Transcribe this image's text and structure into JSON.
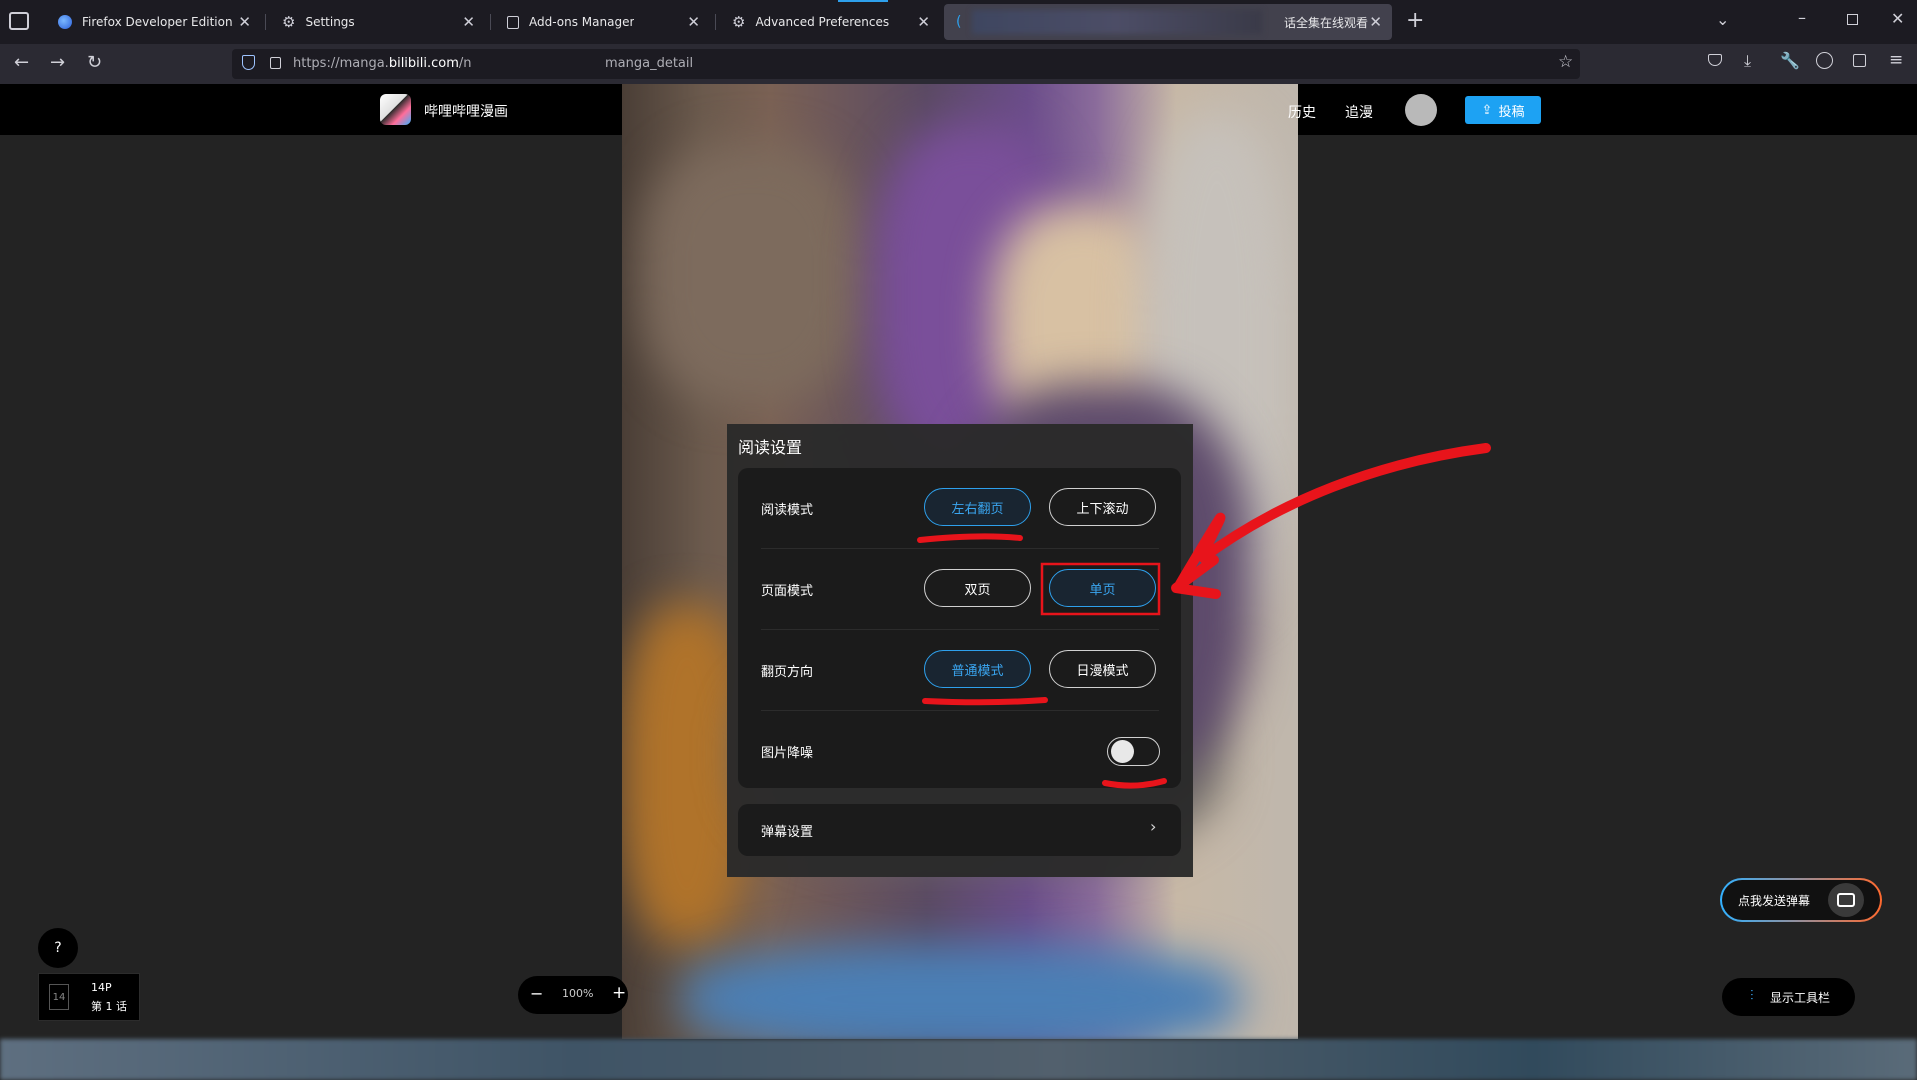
{
  "browser": {
    "tabs": [
      {
        "label": "Firefox Developer Edition",
        "icon": "firefox-icon"
      },
      {
        "label": "Settings",
        "icon": "gear-icon"
      },
      {
        "label": "Add-ons Manager",
        "icon": "puzzle-icon"
      },
      {
        "label": "Advanced Preferences",
        "icon": "gear-icon"
      },
      {
        "label": "话全集在线观看",
        "icon": "loading-icon"
      }
    ],
    "url_prefix": "https://manga.",
    "url_domain": "bilibili.com",
    "url_path": "/n",
    "url_suffix": "manga_detail"
  },
  "site": {
    "logo_text": "哔哩哔哩漫画",
    "nav_history": "历史",
    "nav_follow": "追漫",
    "upload_label": "投稿"
  },
  "settings": {
    "title": "阅读设置",
    "reading_mode_label": "阅读模式",
    "reading_mode_options": [
      "左右翻页",
      "上下滚动"
    ],
    "reading_mode_selected": "左右翻页",
    "page_mode_label": "页面模式",
    "page_mode_options": [
      "双页",
      "单页"
    ],
    "page_mode_selected": "单页",
    "direction_label": "翻页方向",
    "direction_options": [
      "普通模式",
      "日漫模式"
    ],
    "direction_selected": "普通模式",
    "denoise_label": "图片降噪",
    "denoise_on": false,
    "danmaku_settings_label": "弹幕设置"
  },
  "controls": {
    "send_danmaku_label": "点我发送弹幕",
    "show_toolbar_label": "显示工具栏",
    "help_label": "?",
    "page_thumb": "14",
    "page_count": "14P",
    "chapter_label": "第 1 话",
    "zoom_level": "100%",
    "zoom_minus": "−",
    "zoom_plus": "+"
  },
  "annotation_color": "#e8141b",
  "accent_color": "#2ea0ec"
}
